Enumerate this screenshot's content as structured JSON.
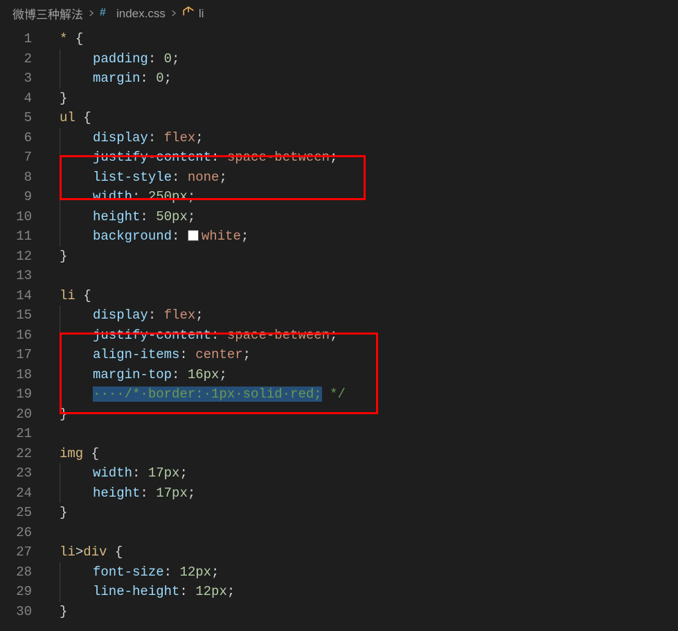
{
  "breadcrumbs": {
    "items": [
      {
        "label": "微博三种解法",
        "icon": null
      },
      {
        "label": "index.css",
        "icon": "css-file-icon"
      },
      {
        "label": "li",
        "icon": "symbol-li-icon"
      }
    ]
  },
  "editor": {
    "filename": "index.css",
    "line_start": 1,
    "line_end": 30,
    "code_lines": [
      {
        "n": 1,
        "indent": 0,
        "tokens": [
          [
            "sel",
            "* "
          ],
          [
            "brace",
            "{"
          ]
        ]
      },
      {
        "n": 2,
        "indent": 1,
        "tokens": [
          [
            "prop",
            "padding"
          ],
          [
            "punct",
            ": "
          ],
          [
            "num",
            "0"
          ],
          [
            "punct",
            ";"
          ]
        ]
      },
      {
        "n": 3,
        "indent": 1,
        "tokens": [
          [
            "prop",
            "margin"
          ],
          [
            "punct",
            ": "
          ],
          [
            "num",
            "0"
          ],
          [
            "punct",
            ";"
          ]
        ]
      },
      {
        "n": 4,
        "indent": 0,
        "tokens": [
          [
            "brace",
            "}"
          ]
        ]
      },
      {
        "n": 5,
        "indent": 0,
        "tokens": [
          [
            "sel",
            "ul "
          ],
          [
            "brace",
            "{"
          ]
        ]
      },
      {
        "n": 6,
        "indent": 1,
        "tokens": [
          [
            "prop",
            "display"
          ],
          [
            "punct",
            ": "
          ],
          [
            "val",
            "flex"
          ],
          [
            "punct",
            ";"
          ]
        ]
      },
      {
        "n": 7,
        "indent": 1,
        "tokens": [
          [
            "prop",
            "justify-content"
          ],
          [
            "punct",
            ": "
          ],
          [
            "val",
            "space-between"
          ],
          [
            "punct",
            ";"
          ]
        ]
      },
      {
        "n": 8,
        "indent": 1,
        "tokens": [
          [
            "prop",
            "list-style"
          ],
          [
            "punct",
            ": "
          ],
          [
            "val",
            "none"
          ],
          [
            "punct",
            ";"
          ]
        ]
      },
      {
        "n": 9,
        "indent": 1,
        "tokens": [
          [
            "prop",
            "width"
          ],
          [
            "punct",
            ": "
          ],
          [
            "num",
            "250px"
          ],
          [
            "punct",
            ";"
          ]
        ]
      },
      {
        "n": 10,
        "indent": 1,
        "tokens": [
          [
            "prop",
            "height"
          ],
          [
            "punct",
            ": "
          ],
          [
            "num",
            "50px"
          ],
          [
            "punct",
            ";"
          ]
        ]
      },
      {
        "n": 11,
        "indent": 1,
        "tokens": [
          [
            "prop",
            "background"
          ],
          [
            "punct",
            ": "
          ],
          [
            "swatch",
            ""
          ],
          [
            "val",
            "white"
          ],
          [
            "punct",
            ";"
          ]
        ]
      },
      {
        "n": 12,
        "indent": 0,
        "tokens": [
          [
            "brace",
            "}"
          ]
        ]
      },
      {
        "n": 13,
        "indent": 0,
        "tokens": []
      },
      {
        "n": 14,
        "indent": 0,
        "tokens": [
          [
            "sel",
            "li "
          ],
          [
            "brace",
            "{"
          ]
        ]
      },
      {
        "n": 15,
        "indent": 1,
        "tokens": [
          [
            "prop",
            "display"
          ],
          [
            "punct",
            ": "
          ],
          [
            "val",
            "flex"
          ],
          [
            "punct",
            ";"
          ]
        ]
      },
      {
        "n": 16,
        "indent": 1,
        "tokens": [
          [
            "prop",
            "justify-content"
          ],
          [
            "punct",
            ": "
          ],
          [
            "val",
            "space-between"
          ],
          [
            "punct",
            ";"
          ]
        ]
      },
      {
        "n": 17,
        "indent": 1,
        "tokens": [
          [
            "prop",
            "align-items"
          ],
          [
            "punct",
            ": "
          ],
          [
            "val",
            "center"
          ],
          [
            "punct",
            ";"
          ]
        ]
      },
      {
        "n": 18,
        "indent": 1,
        "tokens": [
          [
            "prop",
            "margin-top"
          ],
          [
            "punct",
            ": "
          ],
          [
            "num",
            "16px"
          ],
          [
            "punct",
            ";"
          ]
        ]
      },
      {
        "n": 19,
        "indent": 1,
        "tokens": [
          [
            "cmt-hl",
            "····/*·border:·1px·solid·red;"
          ],
          [
            "cmt",
            " */"
          ]
        ]
      },
      {
        "n": 20,
        "indent": 0,
        "tokens": [
          [
            "brace",
            "}"
          ]
        ]
      },
      {
        "n": 21,
        "indent": 0,
        "tokens": []
      },
      {
        "n": 22,
        "indent": 0,
        "tokens": [
          [
            "sel",
            "img "
          ],
          [
            "brace",
            "{"
          ]
        ]
      },
      {
        "n": 23,
        "indent": 1,
        "tokens": [
          [
            "prop",
            "width"
          ],
          [
            "punct",
            ": "
          ],
          [
            "num",
            "17px"
          ],
          [
            "punct",
            ";"
          ]
        ]
      },
      {
        "n": 24,
        "indent": 1,
        "tokens": [
          [
            "prop",
            "height"
          ],
          [
            "punct",
            ": "
          ],
          [
            "num",
            "17px"
          ],
          [
            "punct",
            ";"
          ]
        ]
      },
      {
        "n": 25,
        "indent": 0,
        "tokens": [
          [
            "brace",
            "}"
          ]
        ]
      },
      {
        "n": 26,
        "indent": 0,
        "tokens": []
      },
      {
        "n": 27,
        "indent": 0,
        "tokens": [
          [
            "sel",
            "li"
          ],
          [
            "punct",
            ">"
          ],
          [
            "sel",
            "div "
          ],
          [
            "brace",
            "{"
          ]
        ]
      },
      {
        "n": 28,
        "indent": 1,
        "tokens": [
          [
            "prop",
            "font-size"
          ],
          [
            "punct",
            ": "
          ],
          [
            "num",
            "12px"
          ],
          [
            "punct",
            ";"
          ]
        ]
      },
      {
        "n": 29,
        "indent": 1,
        "tokens": [
          [
            "prop",
            "line-height"
          ],
          [
            "punct",
            ": "
          ],
          [
            "num",
            "12px"
          ],
          [
            "punct",
            ";"
          ]
        ]
      },
      {
        "n": 30,
        "indent": 0,
        "tokens": [
          [
            "brace",
            "}"
          ]
        ]
      }
    ],
    "highlights": [
      {
        "kind": "red-box",
        "from_line": 6,
        "to_line": 7
      },
      {
        "kind": "red-box",
        "from_line": 15,
        "to_line": 18
      }
    ],
    "selection": {
      "line": 19,
      "text": "    /* border: 1px solid red;"
    }
  }
}
